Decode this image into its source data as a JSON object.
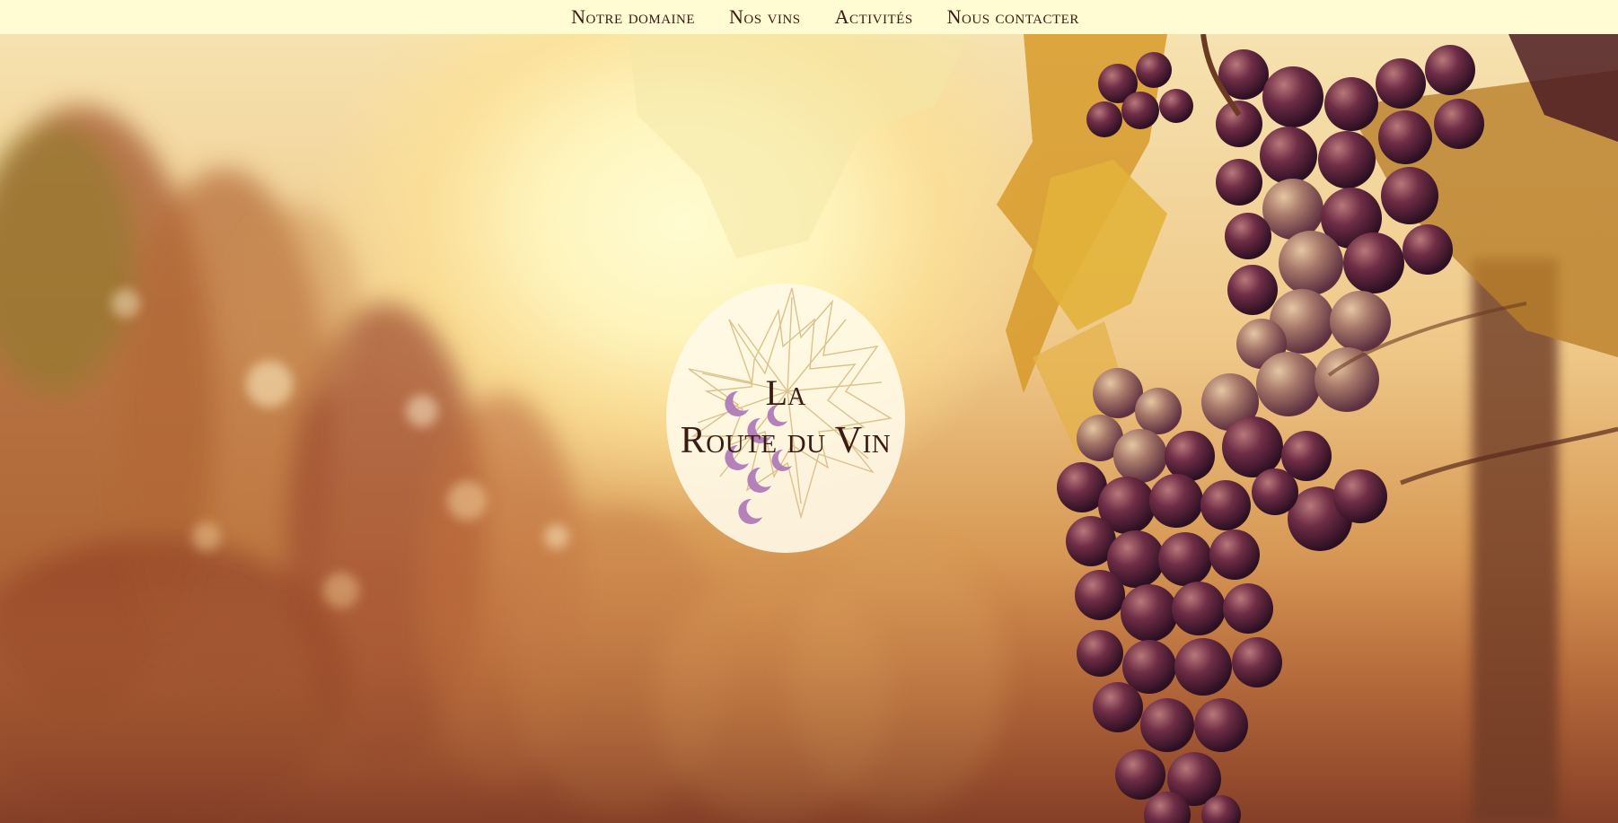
{
  "nav": {
    "items": [
      {
        "label": "Notre domaine"
      },
      {
        "label": "Nos vins"
      },
      {
        "label": "Activités"
      },
      {
        "label": "Nous contacter"
      }
    ]
  },
  "logo": {
    "line1": "La",
    "line2": "Route du Vin",
    "icon": "grape-leaf-icon"
  },
  "hero": {
    "image": "vineyard-sunset-grapes"
  },
  "colors": {
    "nav_background": "#fffbd2",
    "text": "#3b1a14",
    "logo_background": "#fffae8",
    "grape": "#5a2438",
    "grape_logo": "#b07ab8",
    "leaf": "#e2c895"
  }
}
